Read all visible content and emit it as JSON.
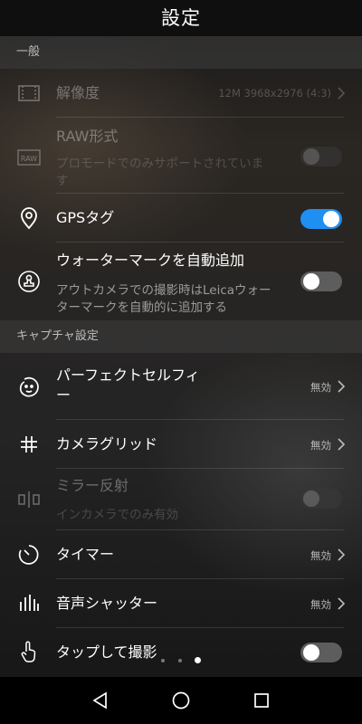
{
  "header": {
    "title": "設定"
  },
  "sections": {
    "general": "一般",
    "capture": "キャプチャ設定"
  },
  "rows": {
    "resolution": {
      "label": "解像度",
      "value": "12M 3968x2976 (4:3)",
      "icon": "resolution-icon"
    },
    "raw": {
      "label": "RAW形式",
      "sub1": "プロモードでのみサポートされていま",
      "sub2": "す",
      "icon": "raw-icon"
    },
    "gps": {
      "label": "GPSタグ",
      "toggle": "on",
      "icon": "location-pin-icon"
    },
    "watermark": {
      "label": "ウォーターマークを自動追加",
      "sub1": "アウトカメラでの撮影時はLeicaウォー",
      "sub2": "ターマークを自動的に追加する",
      "toggle": "off",
      "icon": "stamp-icon"
    },
    "selfie": {
      "label1": "パーフェクトセルフィ",
      "label2": "ー",
      "value": "無効",
      "icon": "face-icon"
    },
    "grid": {
      "label": "カメラグリッド",
      "value": "無効",
      "icon": "grid-icon"
    },
    "mirror": {
      "label": "ミラー反射",
      "sub": "インカメラでのみ有効",
      "toggle": "disabled",
      "icon": "mirror-icon"
    },
    "timer": {
      "label": "タイマー",
      "value": "無効",
      "icon": "timer-icon"
    },
    "audio": {
      "label": "音声シャッター",
      "value": "無効",
      "icon": "audio-bars-icon"
    },
    "tap": {
      "label": "タップして撮影",
      "toggle": "off",
      "icon": "tap-hand-icon"
    }
  },
  "pager": {
    "count": 3,
    "active": 3
  },
  "colors": {
    "toggle_on": "#1f8ff2",
    "toggle_off": "#5d5d5d",
    "background": "#141414"
  },
  "navbar": {
    "back": "back-triangle-icon",
    "home": "home-circle-icon",
    "recents": "recents-square-icon"
  }
}
